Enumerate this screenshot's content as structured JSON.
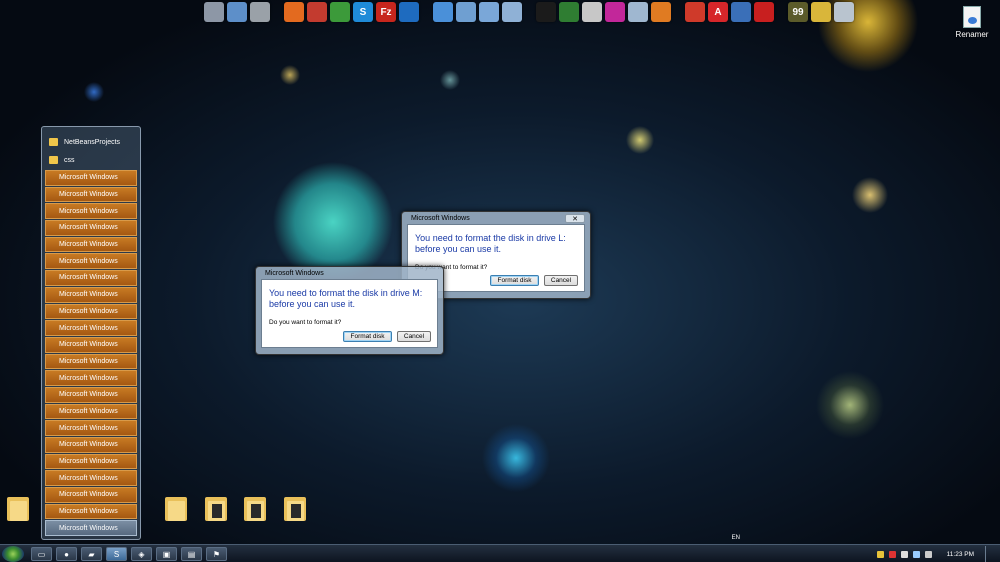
{
  "top_dock": {
    "group1": [
      {
        "icon": "computer-icon",
        "color": "#8d97a6"
      },
      {
        "icon": "network-globe-icon",
        "color": "#5d8fc9"
      },
      {
        "icon": "tools-icon",
        "color": "#9aa1a8"
      }
    ],
    "group2": [
      {
        "icon": "firefox-icon",
        "color": "#e36a1f"
      },
      {
        "icon": "speedometer-icon",
        "color": "#c33b2f"
      },
      {
        "icon": "chrome-icon",
        "color": "#3c9a3a"
      },
      {
        "icon": "skype-icon",
        "color": "#1f8bd8",
        "glyph": "S"
      },
      {
        "icon": "filezilla-icon",
        "color": "#c7261d",
        "glyph": "Fz"
      },
      {
        "icon": "teamviewer-icon",
        "color": "#1e6bbf"
      }
    ],
    "group3": [
      {
        "icon": "dropbox-icon",
        "color": "#4a90d9"
      },
      {
        "icon": "folder-blue-icon",
        "color": "#6f9fd1"
      },
      {
        "icon": "folder-open-icon",
        "color": "#7aa7d8"
      },
      {
        "icon": "folder-network-icon",
        "color": "#8fb1d6"
      }
    ],
    "group4": [
      {
        "icon": "terminal-icon",
        "color": "#1b1b1b"
      },
      {
        "icon": "monitor-green-icon",
        "color": "#2f7d32"
      },
      {
        "icon": "bars-icon",
        "color": "#c7c7c7"
      },
      {
        "icon": "magenta-app-icon",
        "color": "#c2279a"
      },
      {
        "icon": "box-icon",
        "color": "#9fb7d0"
      },
      {
        "icon": "xampp-icon",
        "color": "#e07b22"
      }
    ],
    "group5": [
      {
        "icon": "ccleaner-icon",
        "color": "#cf3a2a"
      },
      {
        "icon": "avira-icon",
        "color": "#d6262a",
        "glyph": "A"
      },
      {
        "icon": "virtualbox-icon",
        "color": "#3a6fb8"
      },
      {
        "icon": "flash-icon",
        "color": "#c81f1f"
      }
    ],
    "group6": [
      {
        "icon": "badge-99-icon",
        "color": "#5b5b2a",
        "glyph": "99"
      },
      {
        "icon": "plane-icon",
        "color": "#d9b63a"
      },
      {
        "icon": "recycle-bin-icon",
        "color": "#b9c4cf"
      }
    ]
  },
  "desktop_shortcut": {
    "label": "Renamer"
  },
  "jumplist": {
    "folders": [
      "NetBeansProjects",
      "css"
    ],
    "items": [
      "Microsoft Windows",
      "Microsoft Windows",
      "Microsoft Windows",
      "Microsoft Windows",
      "Microsoft Windows",
      "Microsoft Windows",
      "Microsoft Windows",
      "Microsoft Windows",
      "Microsoft Windows",
      "Microsoft Windows",
      "Microsoft Windows",
      "Microsoft Windows",
      "Microsoft Windows",
      "Microsoft Windows",
      "Microsoft Windows",
      "Microsoft Windows",
      "Microsoft Windows",
      "Microsoft Windows",
      "Microsoft Windows",
      "Microsoft Windows",
      "Microsoft Windows",
      "Microsoft Windows"
    ]
  },
  "dialog_l": {
    "title": "Microsoft Windows",
    "close": "✕",
    "message": "You need to format the disk in drive L: before you can use it.",
    "question": "Do you want to format it?",
    "format_label": "Format disk",
    "cancel_label": "Cancel"
  },
  "dialog_m": {
    "title": "Microsoft Windows",
    "close": "✕",
    "message": "You need to format the disk in drive M: before you can use it.",
    "question": "Do you want to format it?",
    "format_label": "Format disk",
    "cancel_label": "Cancel"
  },
  "taskbar": {
    "buttons": [
      {
        "icon": "windows-explorer-icon",
        "glyph": "▭"
      },
      {
        "icon": "firefox-taskbar-icon",
        "glyph": "●"
      },
      {
        "icon": "folder-taskbar-icon",
        "glyph": "▰"
      },
      {
        "icon": "skype-taskbar-icon",
        "glyph": "S"
      },
      {
        "icon": "app-taskbar-icon",
        "glyph": "◈"
      },
      {
        "icon": "monitor-taskbar-icon",
        "glyph": "▣"
      },
      {
        "icon": "window-taskbar-icon",
        "glyph": "▤"
      },
      {
        "icon": "flag-taskbar-icon",
        "glyph": "⚑"
      }
    ],
    "language": "EN",
    "clock": "11:23 PM"
  }
}
